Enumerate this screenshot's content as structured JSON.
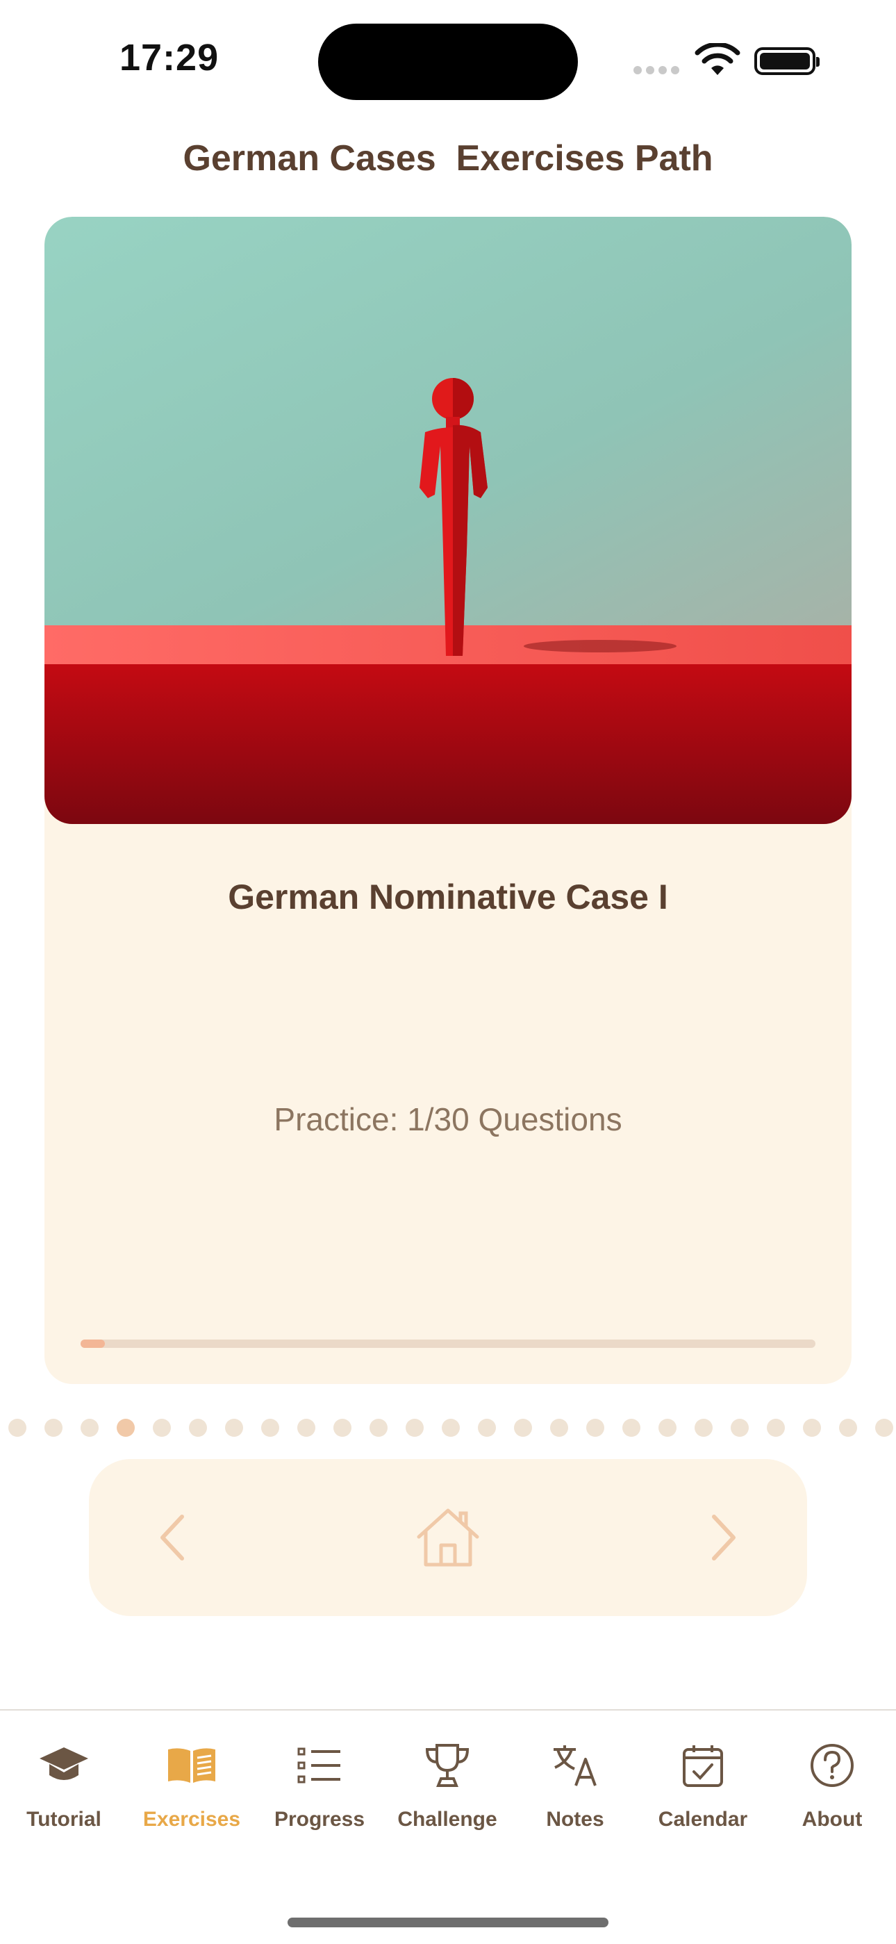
{
  "status_bar": {
    "time": "17:29"
  },
  "page": {
    "title": "German Cases  Exercises Path"
  },
  "card": {
    "title": "German Nominative Case I",
    "practice_text": "Practice: 1/30 Questions",
    "progress_fraction": 0.0333
  },
  "pager": {
    "total_dots": 25,
    "active_index": 3
  },
  "nav_panel": {
    "back_icon": "chevron-left-icon",
    "home_icon": "house-icon",
    "forward_icon": "chevron-right-icon"
  },
  "tab_bar": {
    "items": [
      {
        "label": "Tutorial",
        "icon": "graduation-cap-icon"
      },
      {
        "label": "Exercises",
        "icon": "open-book-icon",
        "active": true
      },
      {
        "label": "Progress",
        "icon": "list-bullets-icon"
      },
      {
        "label": "Challenge",
        "icon": "trophy-icon"
      },
      {
        "label": "Notes",
        "icon": "translate-icon"
      },
      {
        "label": "Calendar",
        "icon": "calendar-check-icon"
      },
      {
        "label": "About",
        "icon": "question-circle-icon"
      }
    ]
  },
  "colors": {
    "accent": "#e8a848",
    "title_text": "#5a4030",
    "card_background": "#fdf4e6",
    "inactive_tab": "#6b5644",
    "progress_fill": "#f3b696"
  }
}
